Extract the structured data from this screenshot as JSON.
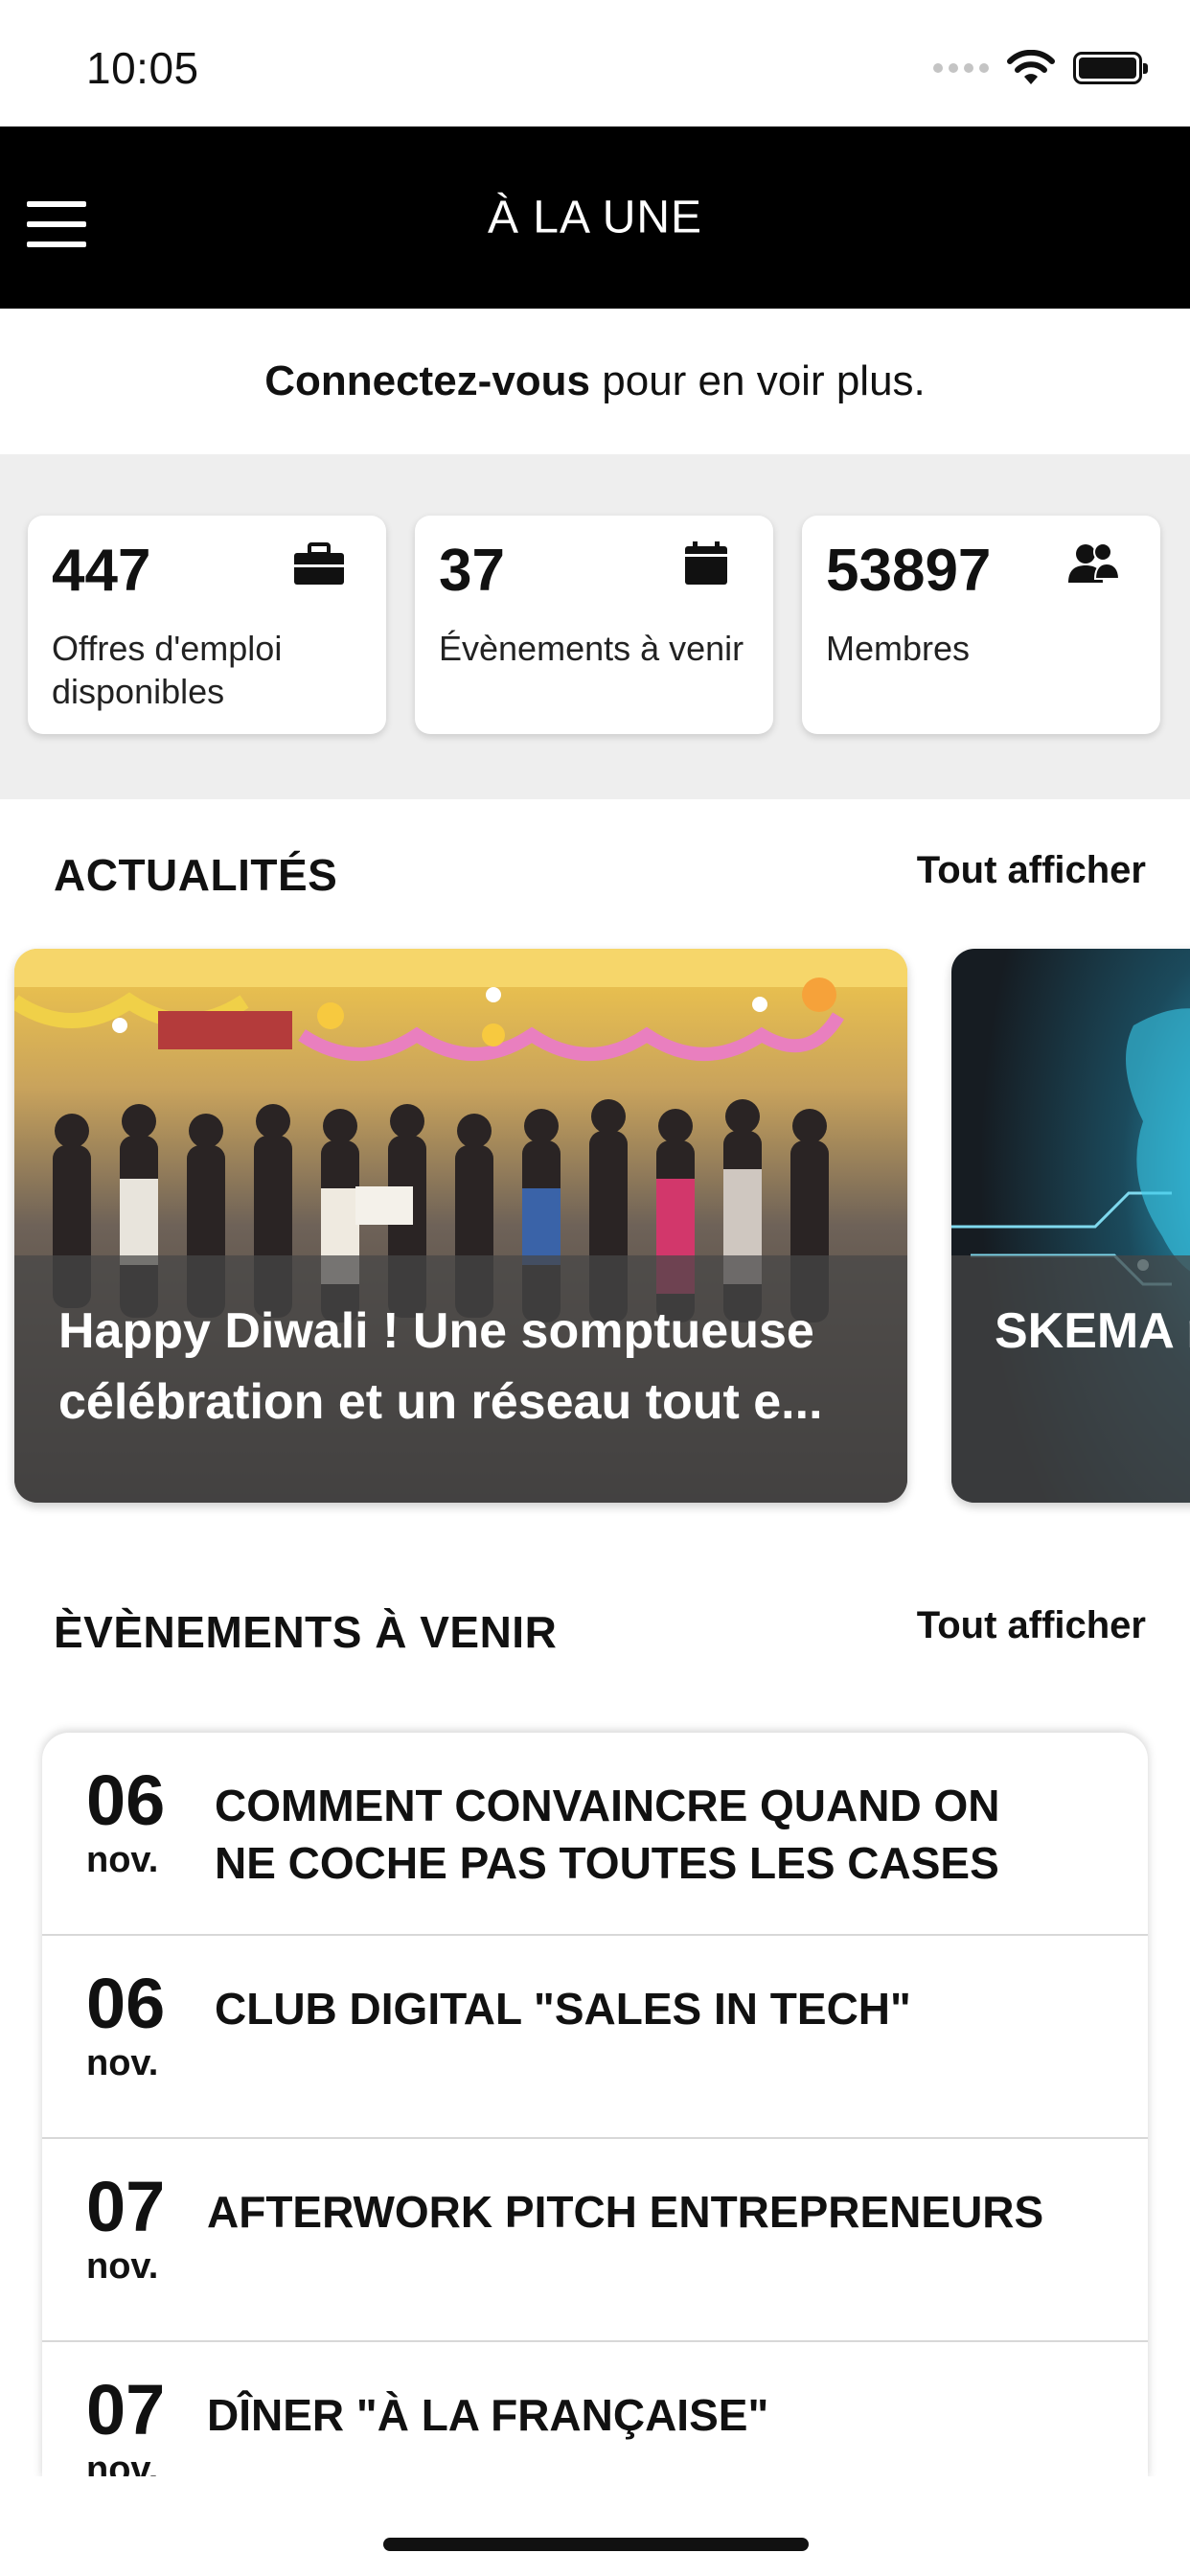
{
  "status_bar": {
    "time": "10:05"
  },
  "header": {
    "title": "À LA UNE",
    "menu_icon": "hamburger-menu-icon"
  },
  "connect_banner": {
    "bold": "Connectez-vous",
    "rest": " pour en voir plus."
  },
  "stats": [
    {
      "value": "447",
      "label": "Offres d'emploi disponibles",
      "icon": "briefcase-icon"
    },
    {
      "value": "37",
      "label": "Évènements à venir",
      "icon": "calendar-icon"
    },
    {
      "value": "53897",
      "label": "Membres",
      "icon": "members-icon"
    }
  ],
  "news": {
    "title": "ACTUALITÉS",
    "see_all": "Tout afficher",
    "items": [
      {
        "title": "Happy Diwali ! Une somptueuse\ncélébration et un réseau tout e..."
      },
      {
        "title": "SKEMA\nrecherc"
      }
    ]
  },
  "events": {
    "title": "ÈVÈNEMENTS À VENIR",
    "see_all": "Tout afficher",
    "items": [
      {
        "day": "06",
        "month": "nov.",
        "title": "COMMENT CONVAINCRE QUAND ON\nNE COCHE PAS TOUTES LES CASES"
      },
      {
        "day": "06",
        "month": "nov.",
        "title": "CLUB DIGITAL \"SALES IN TECH\""
      },
      {
        "day": "07",
        "month": "nov.",
        "title": "AFTERWORK PITCH ENTREPRENEURS"
      },
      {
        "day": "07",
        "month": "nov.",
        "title": "DÎNER \"À LA FRANÇAISE\""
      }
    ]
  },
  "colors": {
    "header_bg": "#000000",
    "stats_bg": "#eeeeee",
    "text": "#111111"
  }
}
